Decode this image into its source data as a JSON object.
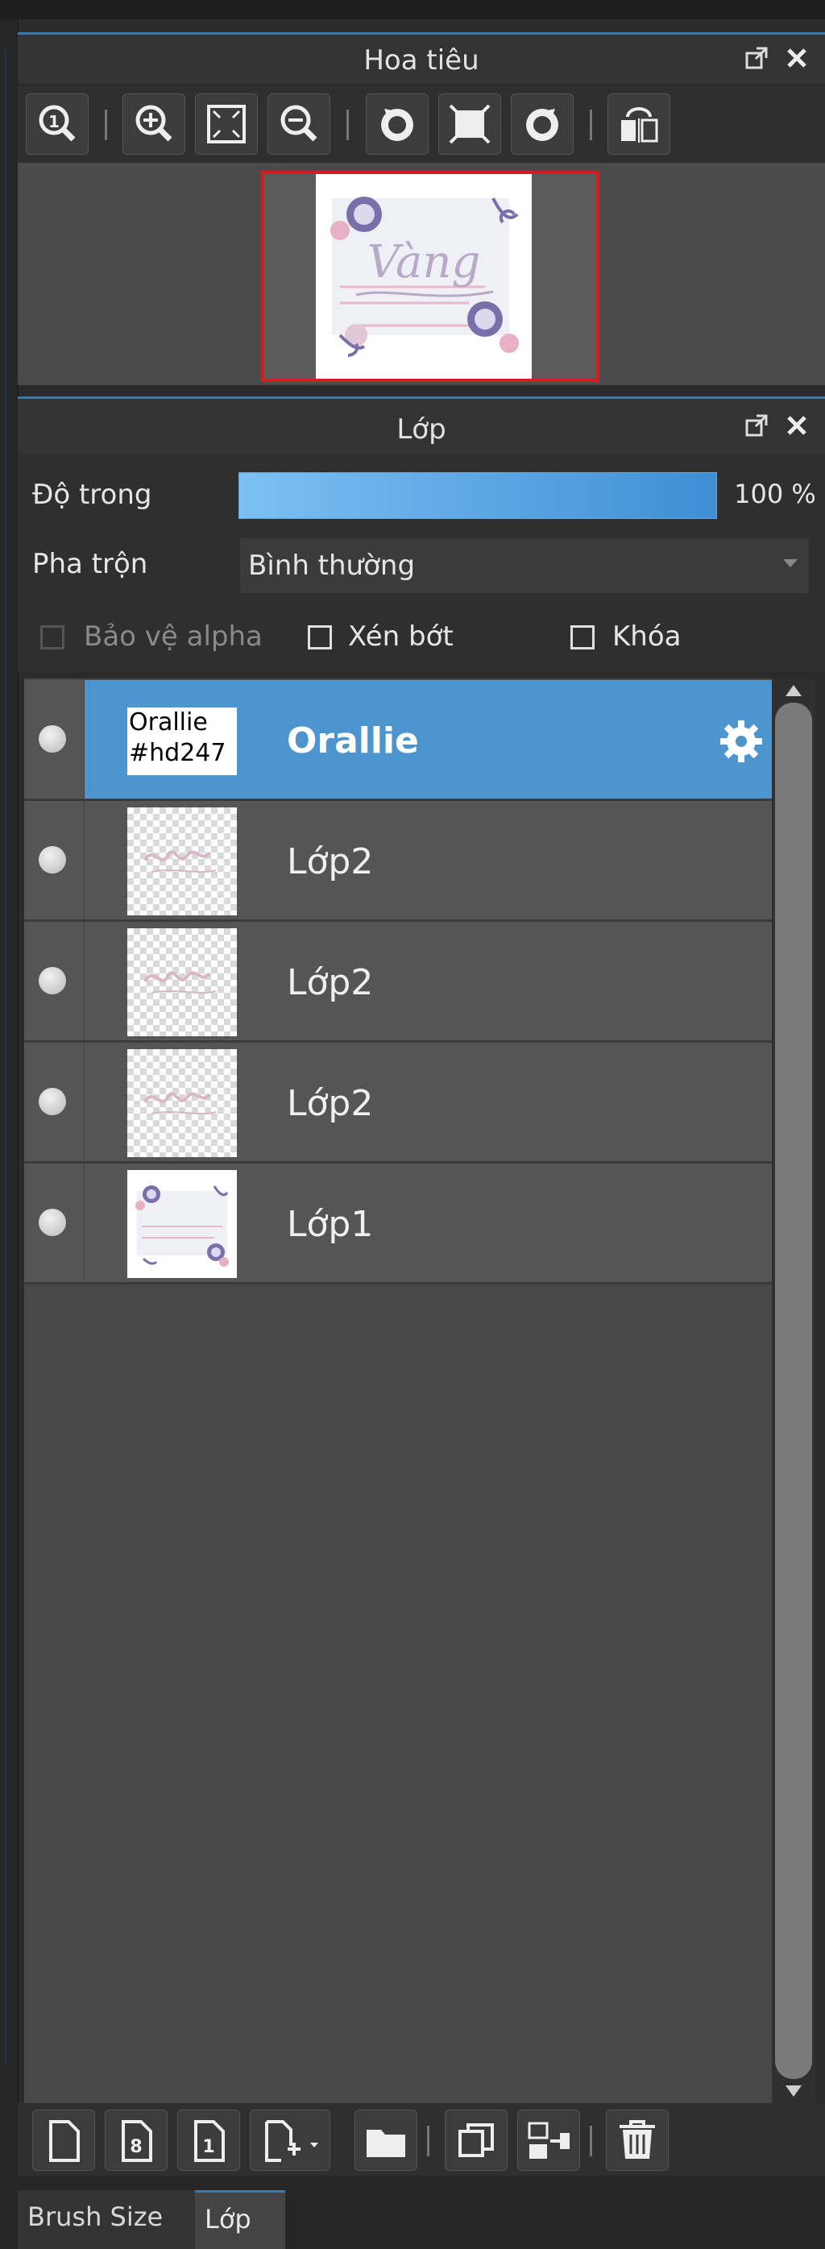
{
  "navigator": {
    "title": "Hoa tiêu",
    "toolbar_icons": [
      "zoom-actual-icon",
      "zoom-in-icon",
      "fit-screen-icon",
      "zoom-out-icon",
      "rotate-left-icon",
      "reset-rotation-icon",
      "rotate-right-icon",
      "flip-horizontal-icon"
    ],
    "thumbnail_text": "Vàng"
  },
  "layers_panel": {
    "title": "Lớp",
    "opacity_label": "Độ trong",
    "opacity_value": "100 %",
    "opacity_fraction": 1.0,
    "blend_label": "Pha trộn",
    "blend_value": "Bình thường",
    "protect_alpha_label": "Bảo vệ alpha",
    "clipping_label": "Xén bớt",
    "lock_label": "Khóa",
    "layers": [
      {
        "name": "Orallie",
        "thumb_text": "Orallie\n#hd247",
        "selected": true
      },
      {
        "name": "Lớp2",
        "selected": false
      },
      {
        "name": "Lớp2",
        "selected": false
      },
      {
        "name": "Lớp2",
        "selected": false
      },
      {
        "name": "Lớp1",
        "selected": false
      }
    ],
    "toolbar_icons": [
      "new-layer-icon",
      "new-8bit-layer-icon",
      "new-1bit-layer-icon",
      "add-layer-menu-icon",
      "new-folder-icon",
      "duplicate-layer-icon",
      "merge-down-icon",
      "delete-layer-icon"
    ]
  },
  "tabs": {
    "brush_size": "Brush Size",
    "layer": "Lớp"
  },
  "colors": {
    "accent": "#4c95cf",
    "selection_frame": "#d21e1e",
    "panel_bg": "#2f2f2f"
  }
}
